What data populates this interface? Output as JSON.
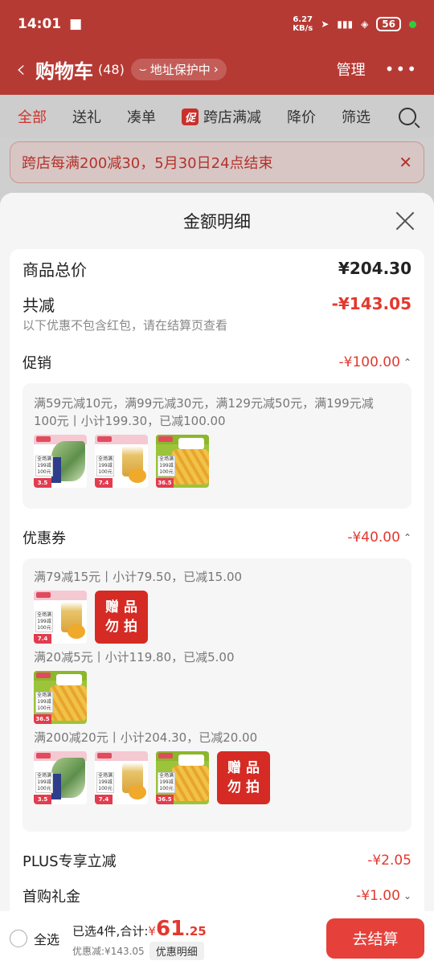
{
  "status_bar": {
    "time": "14:01",
    "speed_value": "6.27",
    "speed_unit": "KB/s",
    "battery": "56"
  },
  "header": {
    "title": "购物车",
    "count": "(48)",
    "address_chip": "地址保护中",
    "manage": "管理"
  },
  "tabs": [
    {
      "label": "全部",
      "active": true
    },
    {
      "label": "送礼"
    },
    {
      "label": "凑单"
    },
    {
      "label": "跨店满减",
      "tag": "促"
    },
    {
      "label": "降价"
    },
    {
      "label": "筛选"
    }
  ],
  "promo_banner": {
    "text": "跨店每满200减30，5月30日24点结束"
  },
  "sheet": {
    "title": "金额明细",
    "total": {
      "label": "商品总价",
      "value": "¥204.30"
    },
    "reduction": {
      "label": "共减",
      "value": "-¥143.05",
      "note": "以下优惠不包含红包，请在结算页查看"
    },
    "promotion": {
      "label": "促销",
      "value": "-¥100.00",
      "rule_line1": "满59元减10元，满99元减30元，满129元减50元，满199元减",
      "rule_line2": "100元丨小计199.30，已减100.00"
    },
    "coupon": {
      "label": "优惠券",
      "value": "-¥40.00",
      "groups": [
        {
          "rule": "满79减15元丨小计79.50，已减15.00"
        },
        {
          "rule": "满20减5元丨小计119.80，已减5.00"
        },
        {
          "rule": "满200减20元丨小计204.30，已减20.00"
        }
      ],
      "gift_text_1": "赠品",
      "gift_text_2": "勿拍"
    },
    "plus": {
      "label": "PLUS专享立减",
      "value": "-¥2.05"
    },
    "first_buy": {
      "label": "首购礼金",
      "value": "-¥1.00"
    }
  },
  "thumb_text": {
    "promo": "全场满199减100元",
    "price_seaweed": "3.5",
    "price_peach": "7.4",
    "price_chips": "36.5"
  },
  "bottom_bar": {
    "select_all": "全选",
    "selected_prefix": "已选4件,合计:",
    "currency": "¥",
    "total_int": "61",
    "total_dec": ".25",
    "discount": "优惠减:¥143.05",
    "detail_chip": "优惠明细",
    "checkout": "去结算"
  }
}
